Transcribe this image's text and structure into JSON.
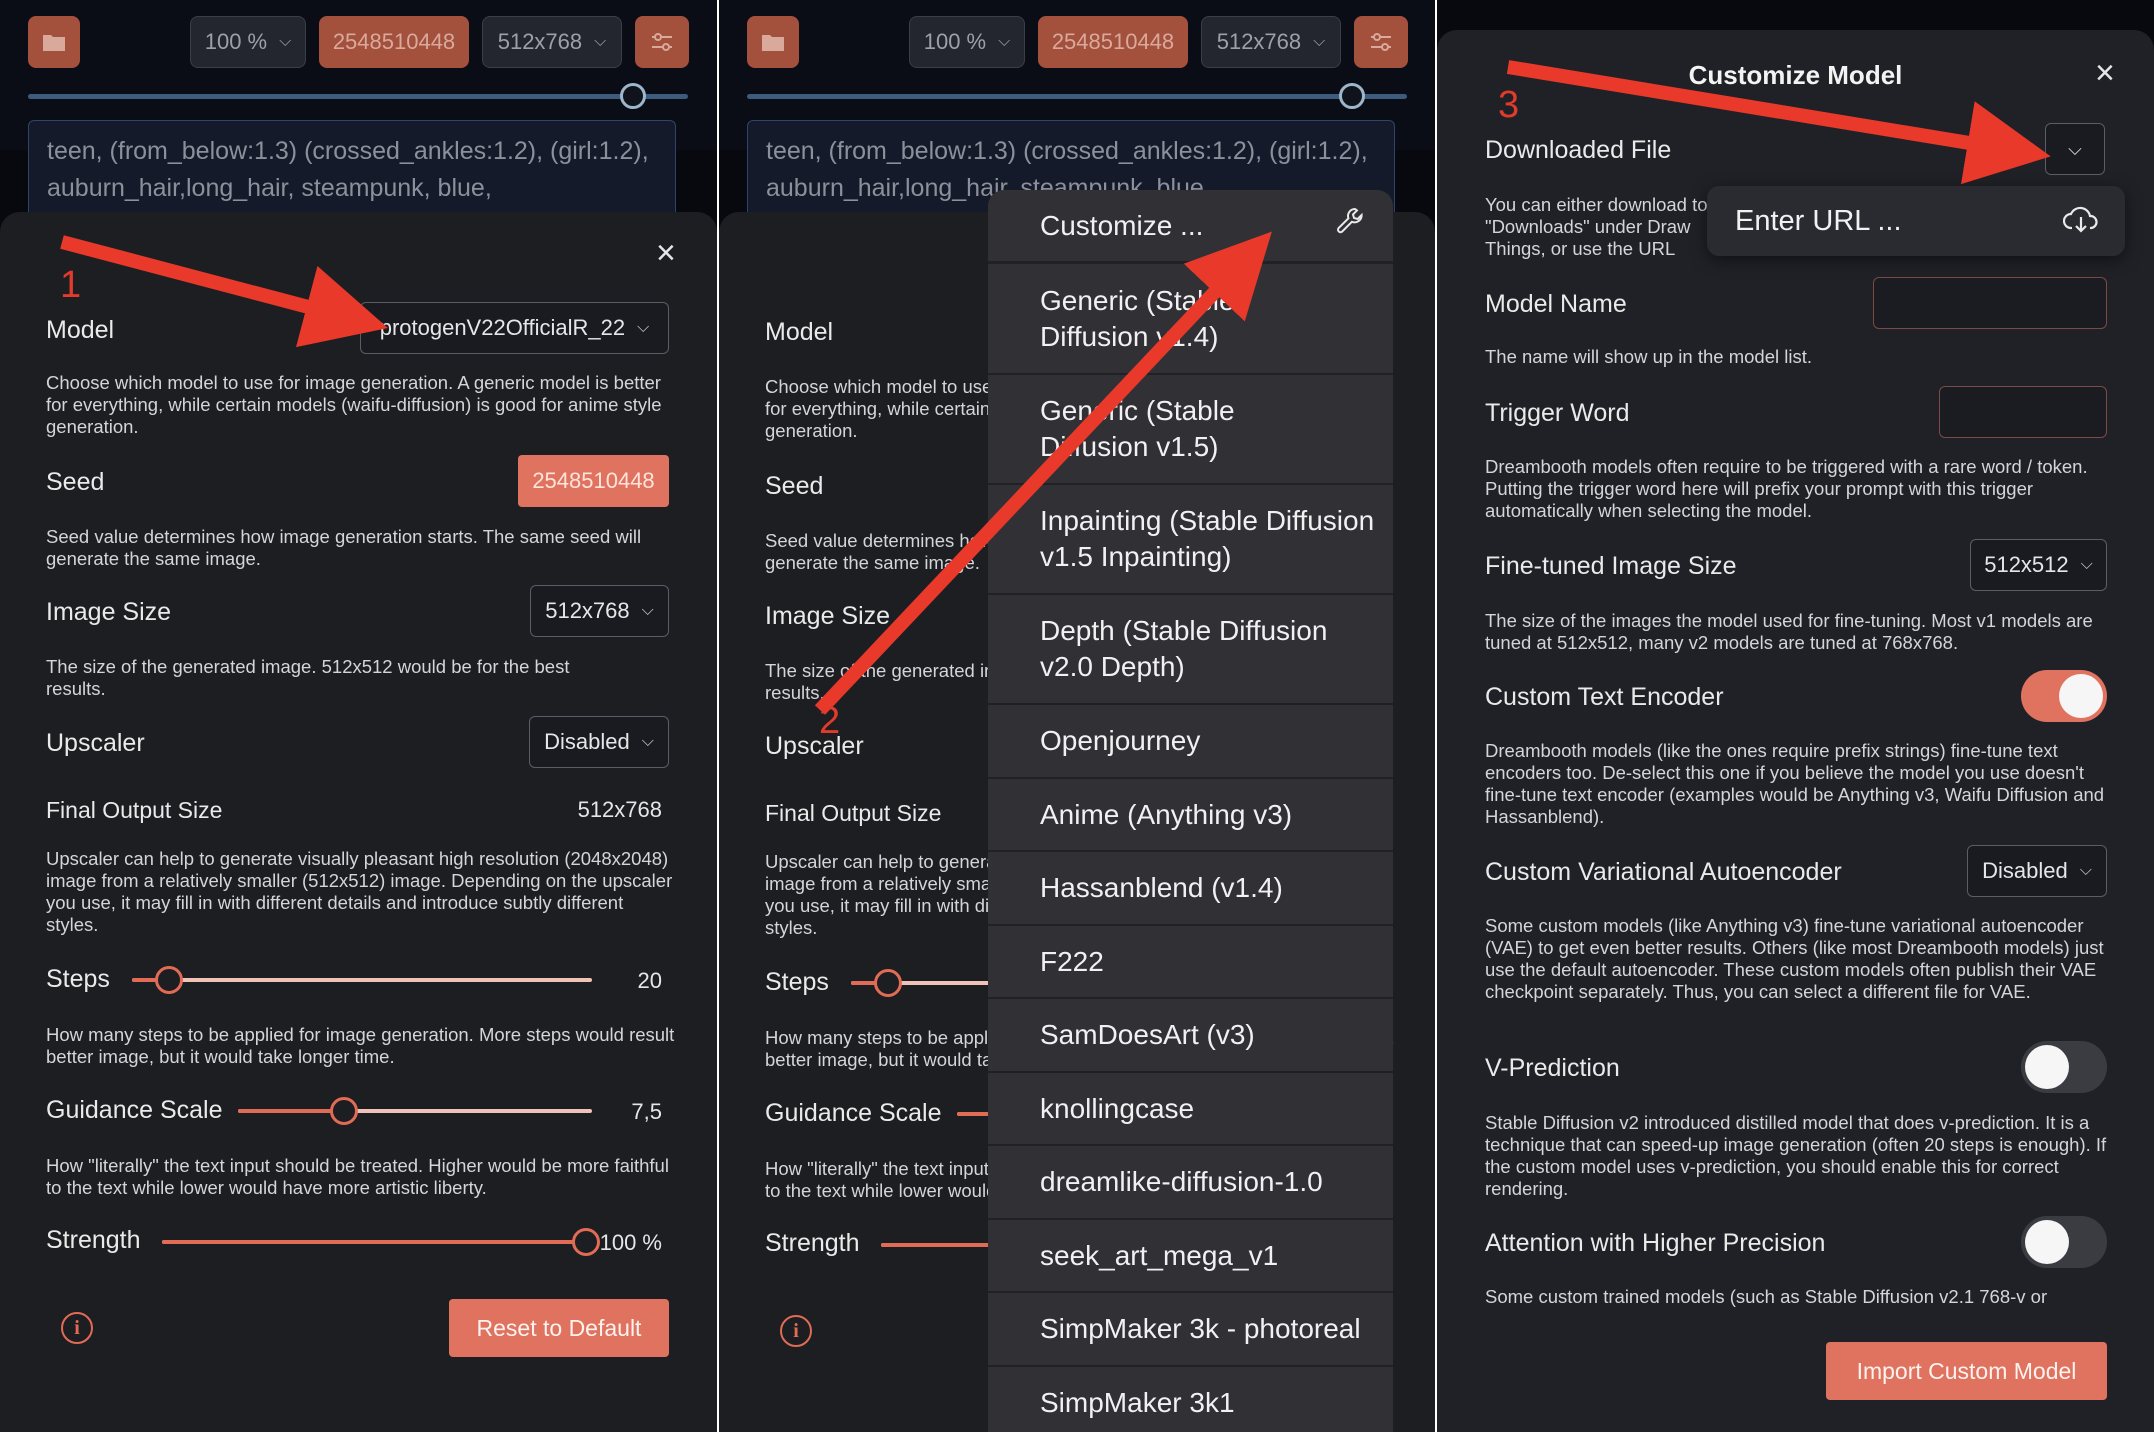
{
  "toolbar": {
    "zoom": "100 %",
    "seed": "2548510448",
    "size": "512x768"
  },
  "prompt_text": "teen, (from_below:1.3) (crossed_ankles:1.2), (girl:1.2), auburn_hair,long_hair, steampunk, blue,",
  "prompt_text_p2": "teen, (from_below:1.3) (crossed_ankles:1.2), (girl:1.2), auburn_hair,long_hair, steampunk, blue,",
  "settings": {
    "model_label": "Model",
    "model_value": "protogenV22OfficialR_22",
    "model_desc": "Choose which model to use for image generation. A generic model is better for everything, while certain models (waifu-diffusion) is good for anime style generation.",
    "seed_label": "Seed",
    "seed_value": "2548510448",
    "seed_desc": "Seed value determines how image generation starts. The same seed will generate the same image.",
    "size_label": "Image Size",
    "size_value": "512x768",
    "size_desc": "The size of the generated image. 512x512 would be for the best results.",
    "upscaler_label": "Upscaler",
    "upscaler_value": "Disabled",
    "final_label": "Final Output Size",
    "final_value": "512x768",
    "upscaler_desc": "Upscaler can help to generate visually pleasant high resolution (2048x2048) image from a relatively smaller (512x512) image. Depending on the upscaler you use, it may fill in with different details and introduce subtly different styles.",
    "steps_label": "Steps",
    "steps_value": "20",
    "steps_fraction": 0.08,
    "steps_desc": "How many steps to be applied for image generation. More steps would result better image, but it would take longer time.",
    "guidance_label": "Guidance Scale",
    "guidance_value": "7,5",
    "guidance_fraction": 0.3,
    "guidance_desc": "How \"literally\" the text input should be treated. Higher would be more faithful to the text while lower would have more artistic liberty.",
    "strength_label": "Strength",
    "strength_value": "100 %",
    "strength_fraction": 1.0,
    "reset_label": "Reset to Default"
  },
  "p2": {
    "model_label": "Model",
    "model_desc": "Choose which model to use for image generation. A generic model is better for everything, while certain models (waifu-diffusion) is good for anime style generation.",
    "seed_label": "Seed",
    "seed_desc": "Seed value determines how image generation starts. The same seed will generate the same image.",
    "size_label": "Image Size",
    "size_desc": "The size of the generated image. 512x512 would be for the best results.",
    "upscaler_label": "Upscaler",
    "final_label": "Final Output Size",
    "upscaler_desc": "Upscaler can help to generate visually pleasant high resolution (2048x2048) image from a relatively smaller (512x512) image. Depending on the upscaler you use, it may fill in with different details and introduce subtly different styles.",
    "steps_label": "Steps",
    "steps_desc": "How many steps to be applied for image generation. More steps would result better image, but it would take longer time.",
    "guidance_label": "Guidance Scale",
    "guidance_desc": "How \"literally\" the text input should be treated. Higher would be more faithful to the text while lower would have more artistic liberty.",
    "strength_label": "Strength"
  },
  "menu": {
    "customize": "Customize ...",
    "items": [
      "Generic (Stable Diffusion v1.4)",
      "Generic (Stable Diffusion v1.5)",
      "Inpainting (Stable Diffusion v1.5 Inpainting)",
      "Depth (Stable Diffusion v2.0 Depth)",
      "Openjourney",
      "Anime (Anything v3)",
      "Hassanblend (v1.4)",
      "F222",
      "SamDoesArt (v3)",
      "knollingcase",
      "dreamlike-diffusion-1.0",
      "seek_art_mega_v1",
      "SimpMaker 3k - photoreal",
      "SimpMaker 3k1"
    ]
  },
  "customize": {
    "title": "Customize Model",
    "downloaded_label": "Downloaded File",
    "downloaded_desc": "You can either download to \"Downloads\" under Draw Things, or use the URL directly to download custom model.",
    "enter_url": "Enter URL ...",
    "name_label": "Model Name",
    "name_desc": "The name will show up in the model list.",
    "trigger_label": "Trigger Word",
    "trigger_desc": "Dreambooth models often require to be triggered with a rare word / token. Putting the trigger word here will prefix your prompt with this trigger automatically when selecting the model.",
    "ft_size_label": "Fine-tuned Image Size",
    "ft_size_value": "512x512",
    "ft_size_desc": "The size of the images the model used for fine-tuning. Most v1 models are tuned at 512x512, many v2 models are tuned at 768x768.",
    "text_encoder_label": "Custom Text Encoder",
    "text_encoder_on": true,
    "text_encoder_desc": "Dreambooth models (like the ones require prefix strings) fine-tune text encoders too. De-select this one if you believe the model you use doesn't fine-tune text encoder (examples would be Anything v3, Waifu Diffusion and Hassanblend).",
    "vae_label": "Custom Variational Autoencoder",
    "vae_value": "Disabled",
    "vae_desc": "Some custom models (like Anything v3) fine-tune variational autoencoder (VAE) to get even better results. Others (like most Dreambooth models) just use the default autoencoder. These custom models often publish their VAE checkpoint separately. Thus, you can select a different file for VAE.",
    "vpred_label": "V-Prediction",
    "vpred_on": false,
    "vpred_desc": "Stable Diffusion v2 introduced distilled model that does v-prediction. It is a technique that can speed-up image generation (often 20 steps is enough). If the custom model uses v-prediction, you should enable this for correct rendering.",
    "attn_label": "Attention with Higher Precision",
    "attn_on": false,
    "attn_desc": "Some custom trained models (such as Stable Diffusion v2.1 768-v or",
    "import_label": "Import Custom Model"
  },
  "annotations": {
    "step1": "1",
    "step2": "2",
    "step3": "3",
    "arrow_color": "#e8392b"
  },
  "colors": {
    "accent": "#e0735f",
    "sheet_bg": "#1d1e22",
    "menu_bg": "#303035"
  }
}
